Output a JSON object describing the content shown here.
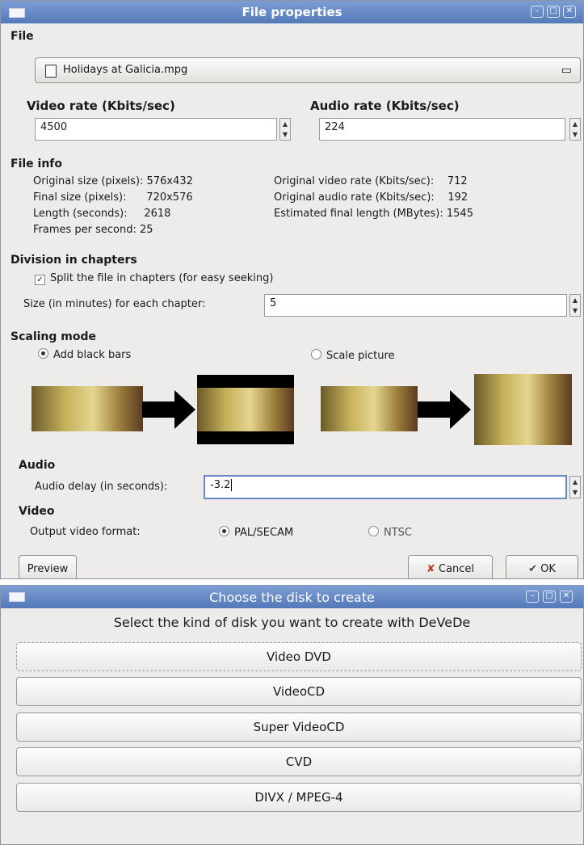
{
  "file_properties": {
    "title": "File properties",
    "file": {
      "section_label": "File",
      "filename": "Holidays at Galicia.mpg"
    },
    "video_rate": {
      "label": "Video rate (Kbits/sec)",
      "value": "4500"
    },
    "audio_rate": {
      "label": "Audio rate (Kbits/sec)",
      "value": "224"
    },
    "file_info": {
      "section_label": "File info",
      "left": [
        {
          "label": "Original size (pixels):",
          "value": "576x432"
        },
        {
          "label": "Final size (pixels):",
          "value": "720x576"
        },
        {
          "label": "Length (seconds):",
          "value": "2618"
        },
        {
          "label": "Frames per second:",
          "value": "25"
        }
      ],
      "right": [
        {
          "label": "Original video rate (Kbits/sec):",
          "value": "712"
        },
        {
          "label": "Original audio rate (Kbits/sec):",
          "value": "192"
        },
        {
          "label": "Estimated final length (MBytes):",
          "value": "1545"
        }
      ]
    },
    "chapters": {
      "section_label": "Division in chapters",
      "split_label": "Split the file in chapters (for easy seeking)",
      "split_checked": true,
      "size_label": "Size (in minutes) for each chapter:",
      "size_value": "5"
    },
    "scaling": {
      "section_label": "Scaling mode",
      "option_black_bars": "Add black bars",
      "option_scale": "Scale picture",
      "selected": "black_bars"
    },
    "audio": {
      "section_label": "Audio",
      "delay_label": "Audio delay (in seconds):",
      "delay_value": "-3.2"
    },
    "video": {
      "section_label": "Video",
      "format_label": "Output video format:",
      "option_pal": "PAL/SECAM",
      "option_ntsc": "NTSC",
      "selected": "pal"
    },
    "buttons": {
      "preview": "Preview",
      "cancel": "Cancel",
      "ok": "OK"
    }
  },
  "disk_chooser": {
    "title": "Choose the disk to create",
    "prompt": "Select the kind of disk you want to create with DeVeDe",
    "options": [
      "Video DVD",
      "VideoCD",
      "Super VideoCD",
      "CVD",
      "DIVX / MPEG-4"
    ]
  },
  "colors": {
    "titlebar": "#5a7fc0",
    "window_bg": "#edecea",
    "cancel_icon": "#c0392b"
  }
}
